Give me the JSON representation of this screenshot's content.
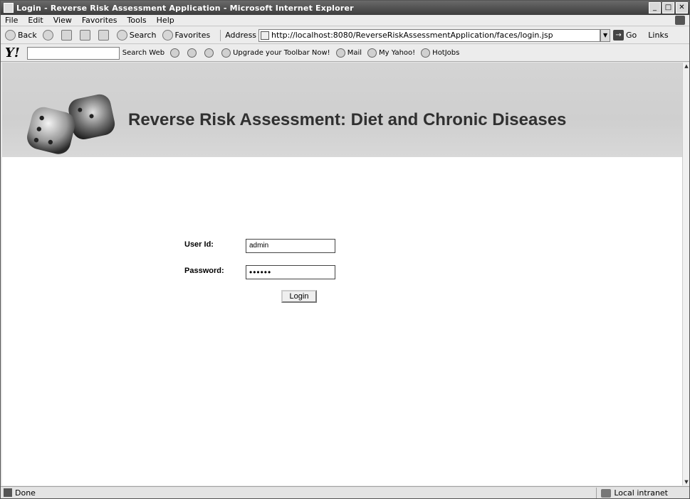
{
  "window": {
    "title": "Login - Reverse Risk Assessment Application - Microsoft Internet Explorer"
  },
  "menubar": {
    "items": [
      "File",
      "Edit",
      "View",
      "Favorites",
      "Tools",
      "Help"
    ]
  },
  "toolbar": {
    "back_label": "Back",
    "search_label": "Search",
    "favorites_label": "Favorites",
    "address_label": "Address",
    "address_value": "http://localhost:8080/ReverseRiskAssessmentApplication/faces/login.jsp",
    "go_label": "Go",
    "links_label": "Links"
  },
  "yahoo_toolbar": {
    "logo": "Y!",
    "search_web_label": "Search Web",
    "upgrade_label": "Upgrade your Toolbar Now!",
    "mail_label": "Mail",
    "my_yahoo_label": "My Yahoo!",
    "hotjobs_label": "HotJobs"
  },
  "page": {
    "banner_title": "Reverse Risk Assessment: Diet and Chronic Diseases",
    "user_id_label": "User Id:",
    "user_id_value": "admin",
    "password_label": "Password:",
    "password_value": "••••••",
    "login_button_label": "Login"
  },
  "statusbar": {
    "status_text": "Done",
    "zone_text": "Local intranet"
  }
}
